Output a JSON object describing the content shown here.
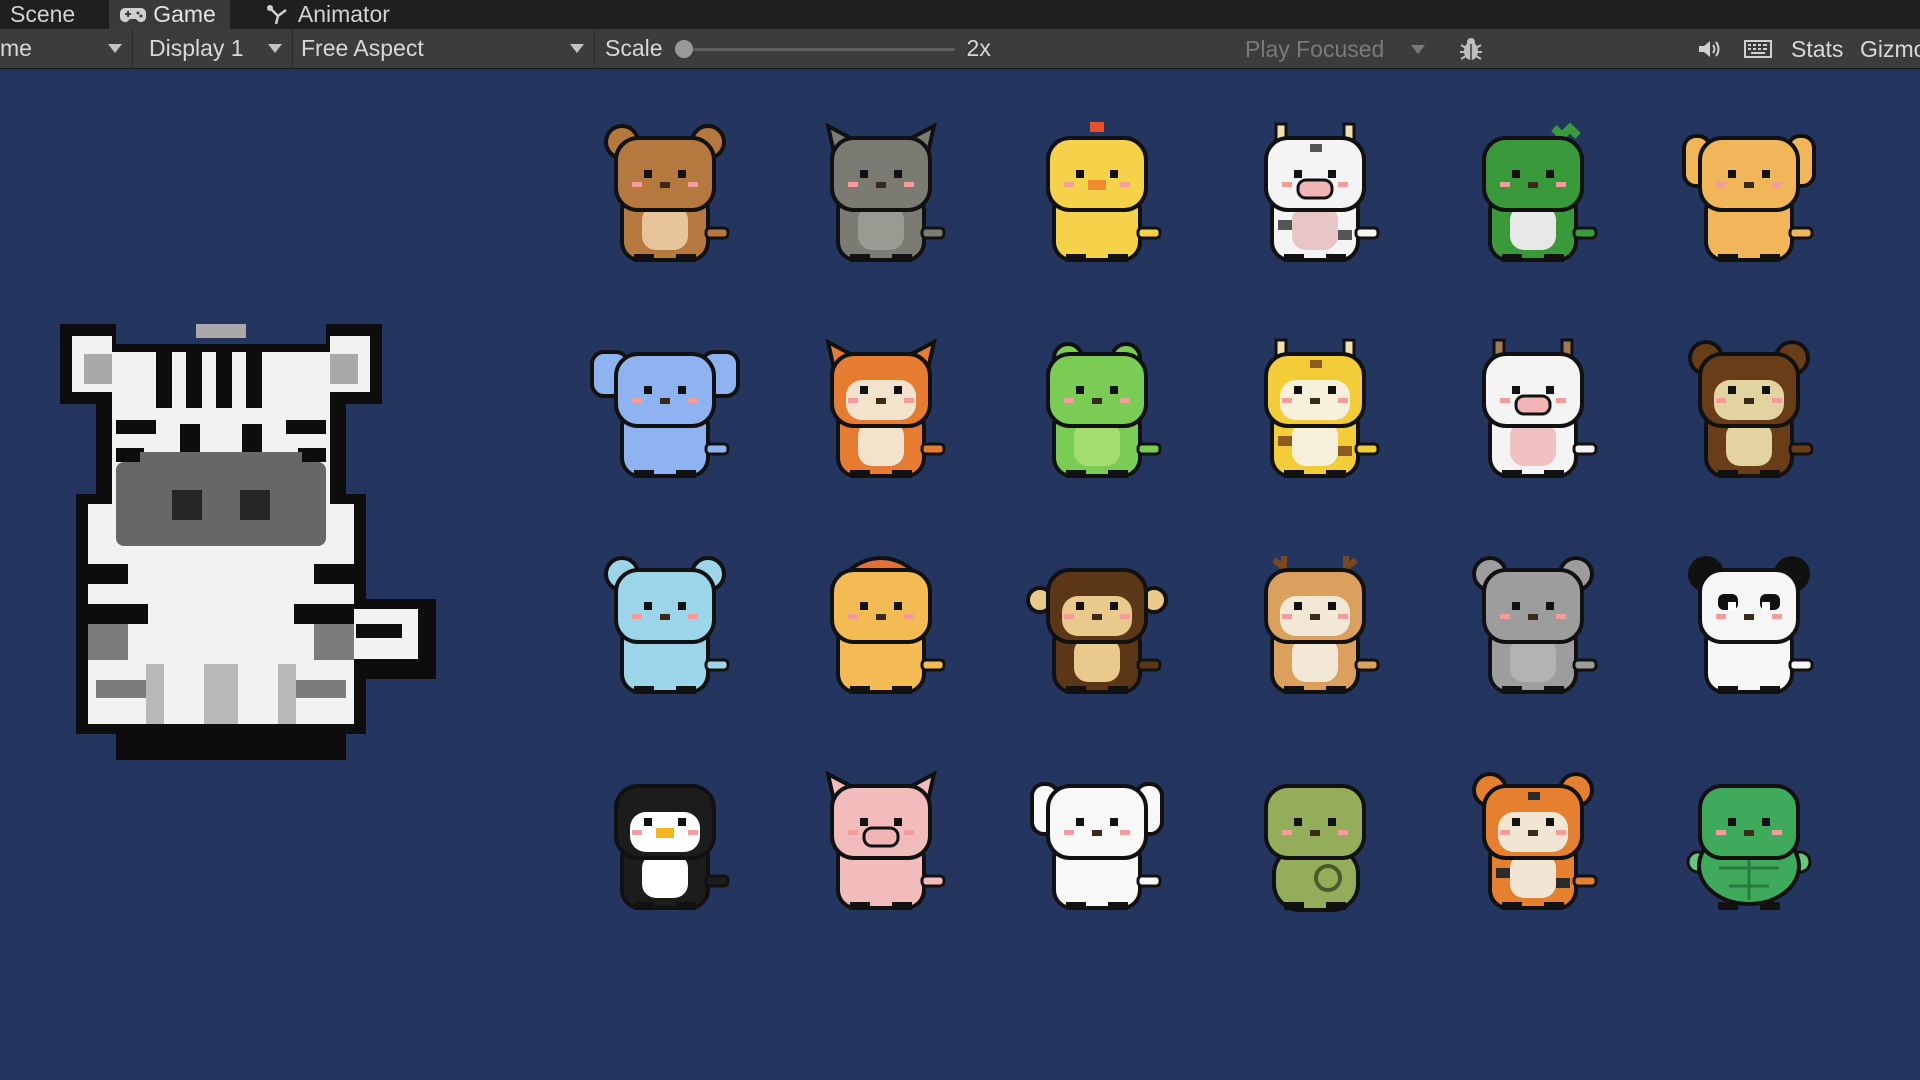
{
  "tabs": [
    {
      "label": "Scene",
      "icon": "scene-icon",
      "active": false
    },
    {
      "label": "Game",
      "icon": "gamepad-icon",
      "active": true
    },
    {
      "label": "Animator",
      "icon": "animator-icon",
      "active": false
    }
  ],
  "toolbar": {
    "game_dropdown": "me",
    "display": "Display 1",
    "aspect": "Free Aspect",
    "scale_label": "Scale",
    "scale_value": "2x",
    "play_mode": "Play Focused",
    "stats_label": "Stats",
    "gizmos_label": "Gizmos",
    "icons": [
      "bug-icon",
      "speaker-icon",
      "keyboard-icon"
    ]
  },
  "sprites": {
    "featured": "zebra",
    "grid": [
      [
        "bear",
        "cat",
        "chick",
        "cow",
        "crocodile",
        "dog"
      ],
      [
        "elephant",
        "fox",
        "frog",
        "giraffe",
        "sheep",
        "gorilla"
      ],
      [
        "hippo",
        "lion",
        "monkey",
        "deer",
        "mouse",
        "panda"
      ],
      [
        "penguin",
        "pig",
        "rabbit",
        "snake",
        "tiger",
        "turtle"
      ]
    ]
  },
  "colors": {
    "background": "#24365f",
    "tabbar": "#1f1f1f",
    "toolbar": "#3c3c3c"
  }
}
